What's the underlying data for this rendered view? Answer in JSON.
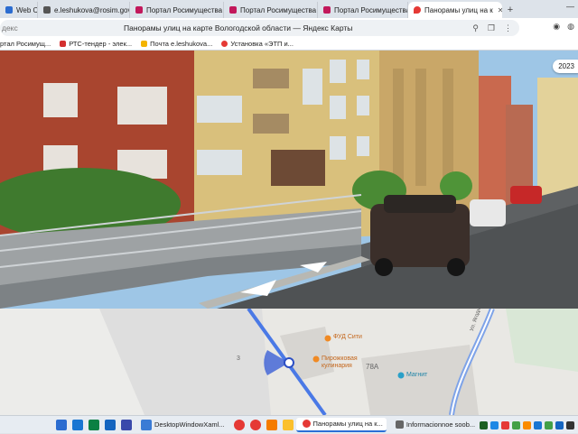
{
  "tabs": [
    {
      "label": "Web Clie",
      "icon": "web-client-icon",
      "color": "#2b6cd0",
      "active": false
    },
    {
      "label": "e.leshukova@rosim.gov",
      "icon": "mail-icon",
      "color": "#555555",
      "active": false
    },
    {
      "label": "Портал Росимущества",
      "icon": "rosim-icon",
      "color": "#c2185b",
      "active": false
    },
    {
      "label": "Портал Росимущества",
      "icon": "rosim-icon",
      "color": "#c2185b",
      "active": false
    },
    {
      "label": "Портал Росимущества",
      "icon": "rosim-icon",
      "color": "#c2185b",
      "active": false
    },
    {
      "label": "Панорамы улиц на к",
      "icon": "yandex-maps-icon",
      "color": "#e53935",
      "active": true
    }
  ],
  "tab_controls": {
    "new_tab": "+",
    "minimize": "—"
  },
  "address_bar": {
    "title": "Панорамы улиц на карте Вологодской области — Яндекс Карты",
    "left_fragment": "декс"
  },
  "bookmarks": [
    {
      "label": "ртал Росимущ...",
      "color": "#c2185b",
      "icon": "rosim-icon"
    },
    {
      "label": "РТС-тендер - элек...",
      "color": "#d32f2f",
      "icon": "rts-icon"
    },
    {
      "label": "Почта e.leshukova...",
      "color": "#f4b400",
      "icon": "mail-icon"
    },
    {
      "label": "Установка «ЭТП и...",
      "color": "#e53935",
      "icon": "etp-icon"
    }
  ],
  "panorama": {
    "year_badge": "2023"
  },
  "map": {
    "labels": [
      {
        "text": "ФУД Сити",
        "kind": "poi-food"
      },
      {
        "text": "Пирожковая кулинария",
        "kind": "poi-bakery"
      },
      {
        "text": "78А",
        "kind": "house-number"
      },
      {
        "text": "Магнит",
        "kind": "poi-shop"
      },
      {
        "text": "3",
        "kind": "house-number"
      },
      {
        "text": "Ул. Ягодная",
        "kind": "street"
      }
    ]
  },
  "taskbar": {
    "apps": [
      {
        "label": "DesktopWindowXaml...",
        "icon": "app-window-icon",
        "color": "#3a7bd5",
        "active": false
      },
      {
        "label": "Панорамы улиц на к...",
        "icon": "yandex-browser-icon",
        "color": "#e53935",
        "active": true
      },
      {
        "label": "Informacionnoe soob...",
        "icon": "document-icon",
        "color": "#666666",
        "active": false
      }
    ],
    "pinned_colors": [
      "#2b6cd0",
      "#1976d2",
      "#0b8043",
      "#1565c0",
      "#3949ab"
    ],
    "tray_colors": [
      "#1b5e20",
      "#1e88e5",
      "#e53935",
      "#43a047",
      "#fb8c00",
      "#1976d2",
      "#43a047",
      "#1565c0",
      "#333333"
    ]
  }
}
